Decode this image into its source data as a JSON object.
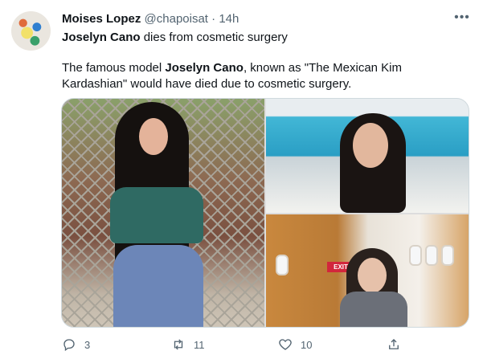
{
  "tweet": {
    "author_name": "Moises Lopez",
    "author_handle": "@chapoisat",
    "separator": "·",
    "time": "14h",
    "more_label": "•••",
    "line1": {
      "bold": "Joselyn Cano",
      "rest": " dies from cosmetic surgery"
    },
    "paragraph": {
      "pre": "The famous model ",
      "bold": "Joselyn Cano",
      "post": ", known as \"The Mexican Kim Kardashian\" would have died due to cosmetic surgery."
    },
    "media": {
      "exit_sign": "EXIT"
    },
    "actions": {
      "reply_count": "3",
      "retweet_count": "11",
      "like_count": "10"
    }
  },
  "colors": {
    "text": "#0f1419",
    "secondary": "#536471",
    "border": "#cfd9de",
    "exit_red": "#d2263c"
  }
}
